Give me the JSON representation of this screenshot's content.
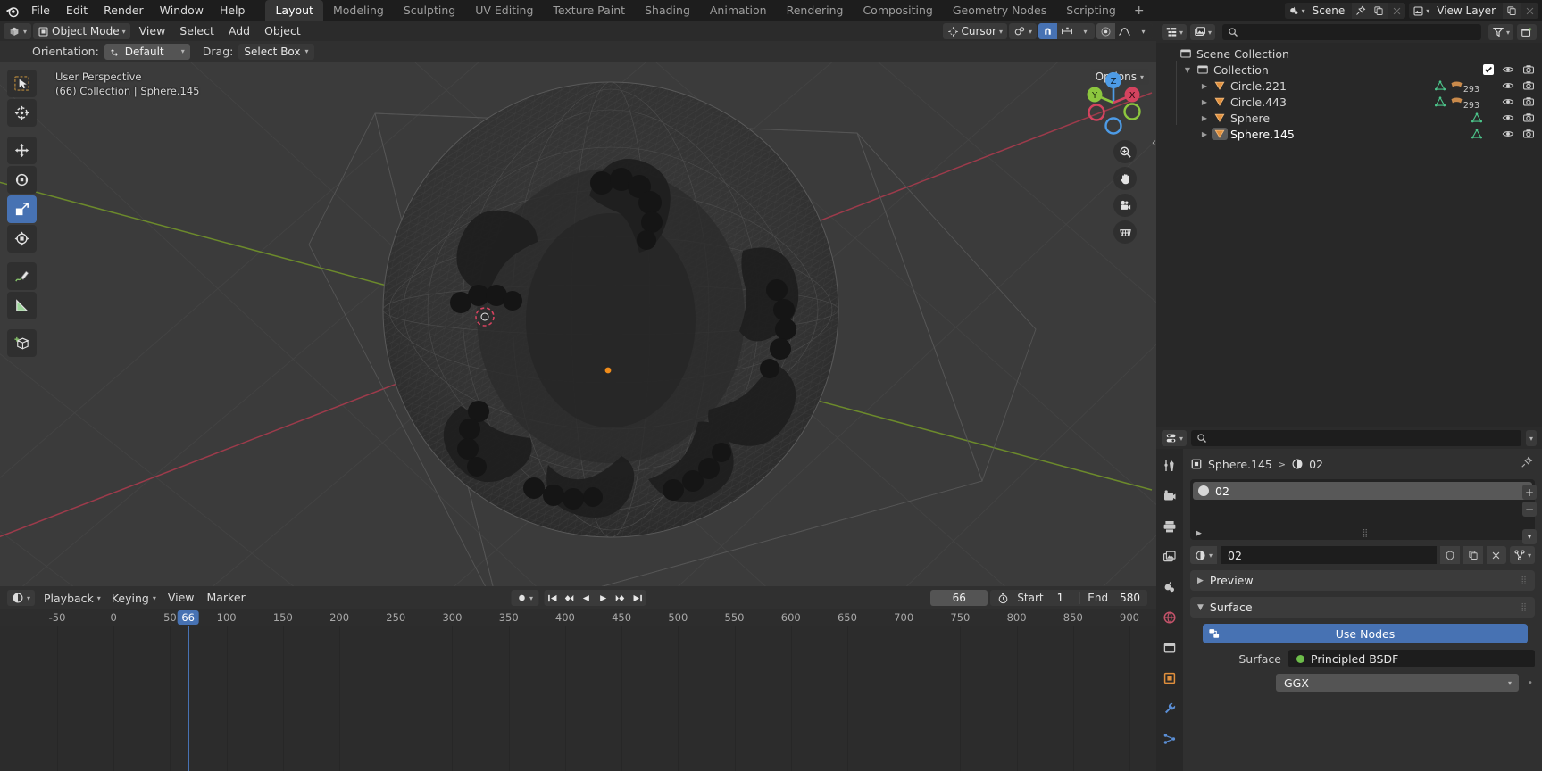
{
  "topbar": {
    "logo_icon": "blender-logo-icon",
    "menus": [
      "File",
      "Edit",
      "Render",
      "Window",
      "Help"
    ],
    "workspaces": [
      {
        "label": "Layout",
        "active": true
      },
      {
        "label": "Modeling",
        "active": false
      },
      {
        "label": "Sculpting",
        "active": false
      },
      {
        "label": "UV Editing",
        "active": false
      },
      {
        "label": "Texture Paint",
        "active": false
      },
      {
        "label": "Shading",
        "active": false
      },
      {
        "label": "Animation",
        "active": false
      },
      {
        "label": "Rendering",
        "active": false
      },
      {
        "label": "Compositing",
        "active": false
      },
      {
        "label": "Geometry Nodes",
        "active": false
      },
      {
        "label": "Scripting",
        "active": false
      }
    ],
    "add_workspace_label": "+",
    "scene_name": "Scene",
    "view_layer_name": "View Layer",
    "scene_icon": "scene-data-icon",
    "view_layer_icon": "view-layer-icon",
    "pin_icon": "pin-icon",
    "copy_icon": "new-copy-icon",
    "close_icon": "close-x-icon"
  },
  "viewport_header": {
    "editor_type_icon": "editor-type-3dview-icon",
    "mode_icon": "object-mode-icon",
    "mode_label": "Object Mode",
    "menus": [
      "View",
      "Select",
      "Add",
      "Object"
    ],
    "transform_pivot_label": "Cursor",
    "pivot_icon": "pivot-cursor-icon",
    "snap_magnet_icon": "snap-magnet-icon",
    "snap_increment_icon": "snap-increment-icon",
    "proportional_icon": "proportional-edit-icon",
    "falloff_icon": "falloff-smooth-icon",
    "right_icons": [
      "visibility-selectability-icon",
      "gizmo-icon",
      "overlays-icon",
      "xray-icon"
    ],
    "shading_modes": [
      "wireframe",
      "solid",
      "material-preview",
      "rendered"
    ],
    "shading_active": "wireframe"
  },
  "tool_settings": {
    "orientation_label": "Orientation:",
    "orientation_value": "Default",
    "orientation_icon": "transform-orientation-icon",
    "drag_label": "Drag:",
    "drag_value": "Select Box"
  },
  "viewport": {
    "overlay_line1": "User Perspective",
    "overlay_line2": "(66) Collection | Sphere.145",
    "options_label": "Options",
    "toolbar": [
      {
        "name": "tweak-select-box-tool",
        "icon": "cursor-select-box-icon",
        "active": false
      },
      {
        "name": "cursor-tool",
        "icon": "3d-cursor-icon",
        "active": false
      },
      {
        "name": "move-tool",
        "icon": "move-arrows-icon",
        "active": false
      },
      {
        "name": "rotate-tool",
        "icon": "rotate-icon",
        "active": false
      },
      {
        "name": "scale-tool",
        "icon": "scale-icon",
        "active": true
      },
      {
        "name": "transform-tool",
        "icon": "transform-icon",
        "active": false
      },
      {
        "name": "annotate-tool",
        "icon": "annotate-pencil-icon",
        "active": false
      },
      {
        "name": "measure-tool",
        "icon": "measure-ruler-icon",
        "active": false
      },
      {
        "name": "add-cube-tool",
        "icon": "add-cube-icon",
        "active": false
      }
    ],
    "gizmo_axes": [
      {
        "label": "Z",
        "color": "#3b7fd4"
      },
      {
        "label": "Y",
        "color": "#8cc63e"
      },
      {
        "label": "X",
        "color": "#d4435f"
      }
    ],
    "nav_buttons": [
      "zoom-icon",
      "pan-hand-icon",
      "camera-icon",
      "toggle-ortho-grid-icon"
    ],
    "grid_color": "#4a4a4a",
    "axis_x_color": "#a33b4c",
    "axis_y_color": "#6f8f2b",
    "background_color": "#3b3b3b",
    "mesh_color": "#2c2c2c"
  },
  "outliner": {
    "display_mode_icon": "outliner-display-mode-icon",
    "filter_id_icon": "outliner-id-type-icon",
    "search_placeholder": "",
    "search_value": "",
    "search_icon": "search-icon",
    "filter_icon": "filter-funnel-icon",
    "new_collection_icon": "new-collection-icon",
    "rows": [
      {
        "label": "Scene Collection",
        "icon": "collection-icon",
        "indent": 0,
        "disclosure": "",
        "selected": false,
        "badges": [],
        "count": null,
        "show_eye": false,
        "show_camera": false,
        "show_check": false
      },
      {
        "label": "Collection",
        "icon": "collection-icon",
        "indent": 1,
        "disclosure": "down",
        "selected": false,
        "badges": [],
        "count": null,
        "show_eye": true,
        "show_camera": true,
        "show_check": true
      },
      {
        "label": "Circle.221",
        "icon": "mesh-object-icon",
        "indent": 2,
        "disclosure": "right",
        "selected": false,
        "badges": [
          "mesh-data-icon",
          "material-data-icon"
        ],
        "count": "293",
        "show_eye": true,
        "show_camera": true,
        "show_check": false
      },
      {
        "label": "Circle.443",
        "icon": "mesh-object-icon",
        "indent": 2,
        "disclosure": "right",
        "selected": false,
        "badges": [
          "mesh-data-icon",
          "material-data-icon"
        ],
        "count": "293",
        "show_eye": true,
        "show_camera": true,
        "show_check": false
      },
      {
        "label": "Sphere",
        "icon": "mesh-object-icon",
        "indent": 2,
        "disclosure": "right",
        "selected": false,
        "badges": [
          "mesh-data-icon"
        ],
        "count": null,
        "show_eye": true,
        "show_camera": true,
        "show_check": false
      },
      {
        "label": "Sphere.145",
        "icon": "mesh-object-icon",
        "indent": 2,
        "disclosure": "right",
        "selected": true,
        "badges": [
          "mesh-data-icon"
        ],
        "count": null,
        "show_eye": true,
        "show_camera": true,
        "show_check": false
      }
    ]
  },
  "properties": {
    "editor_icon": "properties-editor-icon",
    "search_value": "",
    "search_icon": "search-icon",
    "expand_icon": "chevron-down-icon",
    "tabs": [
      {
        "name": "tool",
        "icon": "tool-icon",
        "active": false
      },
      {
        "name": "render",
        "icon": "render-camera-back-icon",
        "active": false
      },
      {
        "name": "output",
        "icon": "printer-output-icon",
        "active": false
      },
      {
        "name": "view-layer",
        "icon": "images-viewlayer-icon",
        "active": false
      },
      {
        "name": "scene",
        "icon": "scene-properties-icon",
        "active": false
      },
      {
        "name": "world",
        "icon": "world-globe-icon",
        "active": false
      },
      {
        "name": "collection",
        "icon": "collection-properties-icon",
        "active": false
      },
      {
        "name": "object",
        "icon": "object-square-icon",
        "active": false
      },
      {
        "name": "modifiers",
        "icon": "wrench-icon",
        "active": false
      },
      {
        "name": "particles",
        "icon": "particles-icon",
        "active": false
      }
    ],
    "breadcrumb": {
      "object_icon": "object-square-icon",
      "object_name": "Sphere.145",
      "separator": ">",
      "material_icon": "material-sphere-icon",
      "material_name": "02"
    },
    "pin_icon": "pin-icon",
    "material_slots": [
      {
        "name": "02",
        "selected": true
      }
    ],
    "slot_buttons": [
      "plus-icon",
      "minus-icon",
      "chevron-down-icon"
    ],
    "slot_expand_icon": "chevron-right-icon",
    "material_field": {
      "browse_icon": "material-sphere-icon",
      "name": "02",
      "fake_user_icon": "shield-fake-user-icon",
      "copy_icon": "new-copy-icon",
      "unlink_icon": "close-x-icon",
      "node_tree_icon": "node-tree-icon"
    },
    "panels": [
      {
        "label": "Preview",
        "expanded": false
      },
      {
        "label": "Surface",
        "expanded": true
      }
    ],
    "use_nodes_label": "Use Nodes",
    "use_nodes_icon": "nodetree-icon",
    "surface_label": "Surface",
    "surface_value": "Principled BSDF",
    "distribution_value": "GGX"
  },
  "timeline": {
    "editor_icon": "timeline-editor-icon",
    "menus": [
      {
        "label": "Playback",
        "dropdown": true
      },
      {
        "label": "Keying",
        "dropdown": true
      },
      {
        "label": "View",
        "dropdown": false
      },
      {
        "label": "Marker",
        "dropdown": false
      }
    ],
    "auto_keying_icon": "record-dot-icon",
    "transport_buttons": [
      "jump-to-start-icon",
      "prev-keyframe-icon",
      "play-reverse-icon",
      "play-icon",
      "next-keyframe-icon",
      "jump-to-end-icon"
    ],
    "current_frame": "66",
    "frame_range_icon": "stopwatch-icon",
    "start_label": "Start",
    "start_value": "1",
    "end_label": "End",
    "end_value": "580",
    "ruler_ticks": [
      "-50",
      "0",
      "50",
      "100",
      "150",
      "200",
      "250",
      "300",
      "350",
      "400",
      "450",
      "500",
      "550",
      "600",
      "650",
      "700",
      "750",
      "800",
      "850",
      "900"
    ],
    "playhead_frame": "66",
    "playhead_color": "#4772b3"
  }
}
